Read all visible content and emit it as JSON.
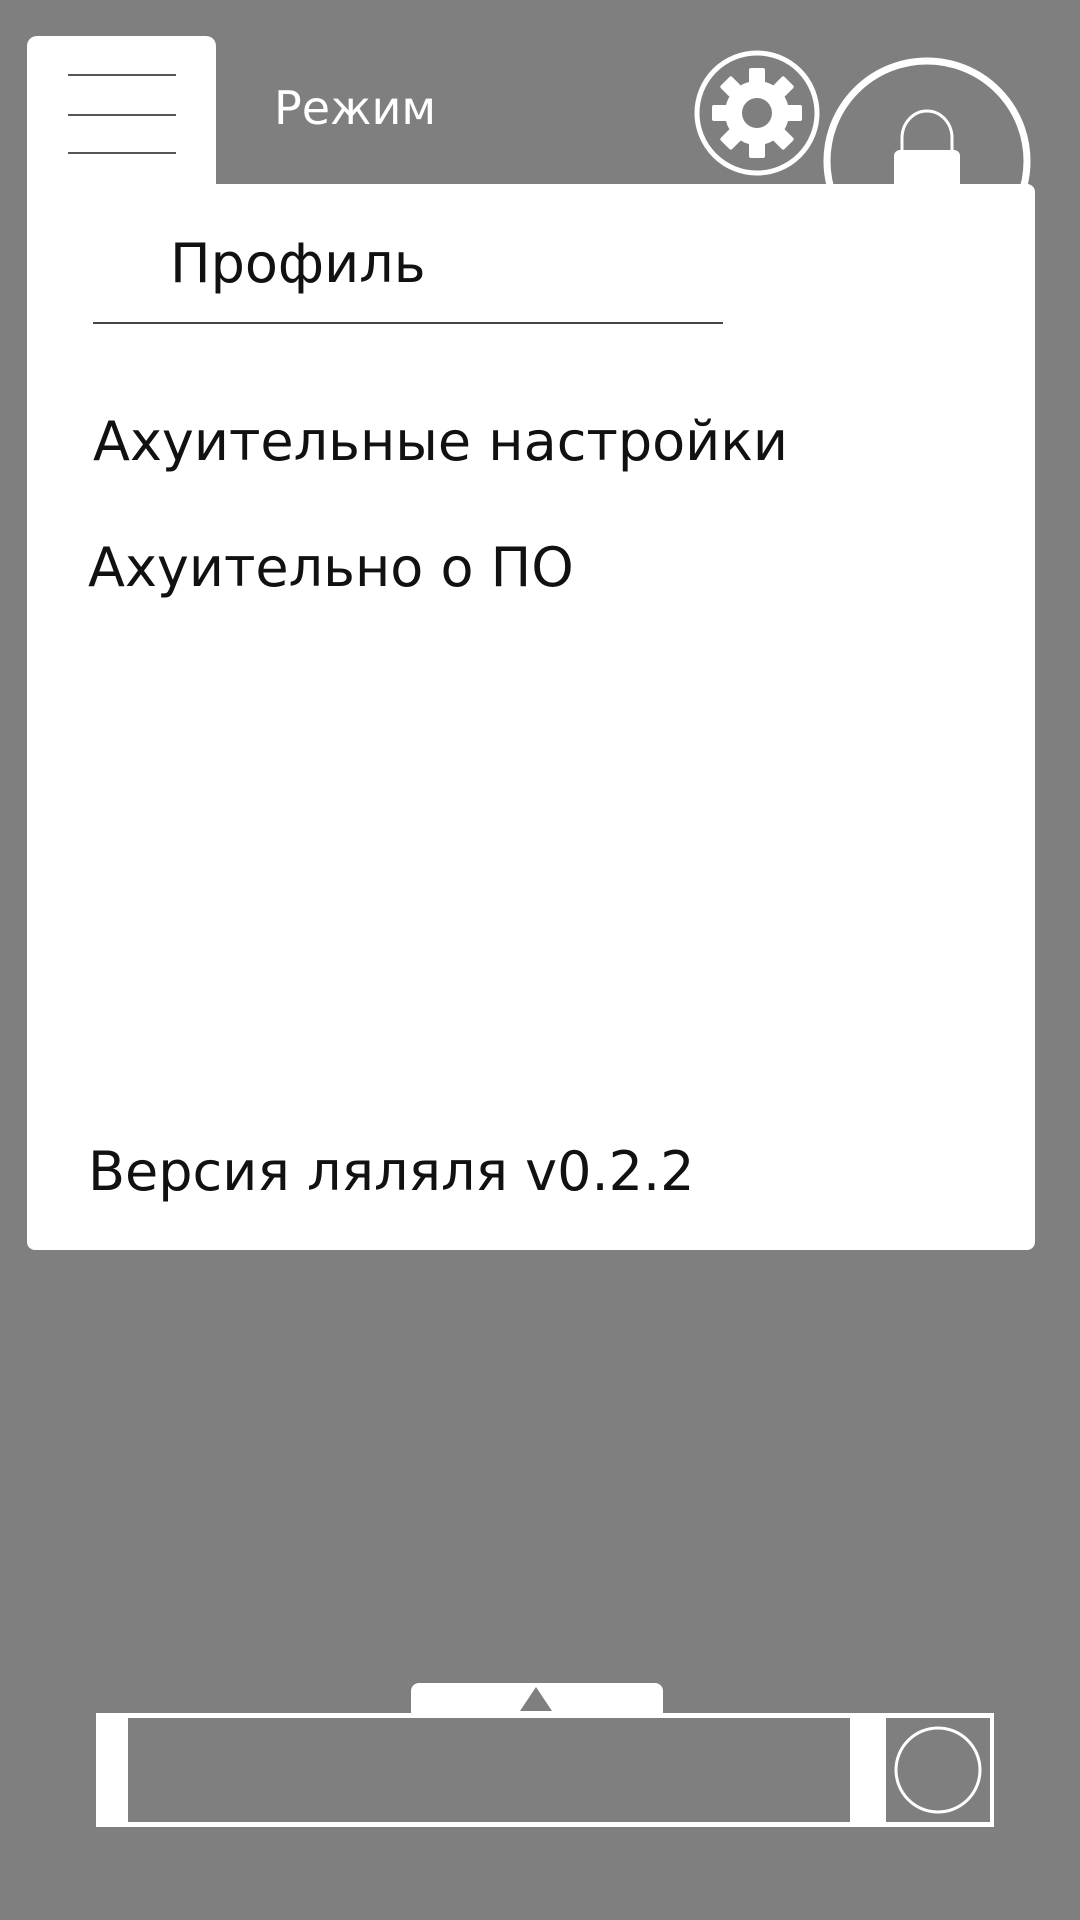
{
  "header": {
    "mode_label": "Режим",
    "menu_icon": "hamburger-icon",
    "settings_icon": "gear-icon",
    "lock_icon": "lock-icon"
  },
  "drawer": {
    "profile_title": "Профиль",
    "items": [
      {
        "label": "Ахуительные настройки"
      },
      {
        "label": "Ахуительно о ПО"
      }
    ],
    "version": "Версия ляляля v0.2.2"
  },
  "bottom": {
    "expand_icon": "triangle-up-icon",
    "action_icon": "circle-icon"
  },
  "colors": {
    "background": "#7f7f7f",
    "panel": "#ffffff",
    "text": "#111111"
  }
}
